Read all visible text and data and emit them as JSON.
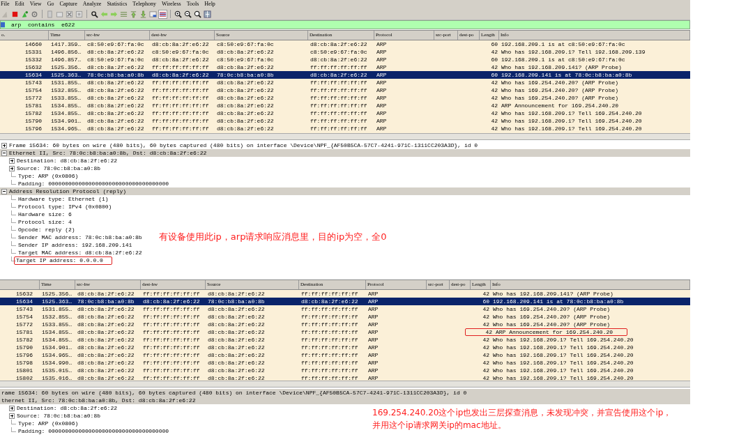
{
  "menu": [
    "File",
    "Edit",
    "View",
    "Go",
    "Capture",
    "Analyze",
    "Statistics",
    "Telephony",
    "Wireless",
    "Tools",
    "Help"
  ],
  "filter": {
    "value": "arp  contains  e622"
  },
  "panes": [
    {
      "columns": [
        "o.",
        "Time",
        "src-hw",
        "dest-hw",
        "Source",
        "Destination",
        "Protocol",
        "src-port",
        "dest-po",
        "Length",
        "Info"
      ],
      "rows": [
        {
          "no": "14660",
          "time": "1417.359…",
          "src_hw": "c8:50:e9:67:fa:0c",
          "dest_hw": "d8:cb:8a:2f:e6:22",
          "source": "c8:50:e9:67:fa:0c",
          "destination": "d8:cb:8a:2f:e6:22",
          "protocol": "ARP",
          "length": "60",
          "info": "192.168.209.1 is at c8:50:e9:67:fa:0c",
          "selected": false
        },
        {
          "no": "15331",
          "time": "1496.856…",
          "src_hw": "d8:cb:8a:2f:e6:22",
          "dest_hw": "c8:50:e9:67:fa:0c",
          "source": "d8:cb:8a:2f:e6:22",
          "destination": "c8:50:e9:67:fa:0c",
          "protocol": "ARP",
          "length": "42",
          "info": "Who has 192.168.209.1? Tell 192.168.209.139",
          "selected": false
        },
        {
          "no": "15332",
          "time": "1496.857…",
          "src_hw": "c8:50:e9:67:fa:0c",
          "dest_hw": "d8:cb:8a:2f:e6:22",
          "source": "c8:50:e9:67:fa:0c",
          "destination": "d8:cb:8a:2f:e6:22",
          "protocol": "ARP",
          "length": "60",
          "info": "192.168.209.1 is at c8:50:e9:67:fa:0c",
          "selected": false
        },
        {
          "no": "15632",
          "time": "1525.356…",
          "src_hw": "d8:cb:8a:2f:e6:22",
          "dest_hw": "ff:ff:ff:ff:ff:ff",
          "source": "d8:cb:8a:2f:e6:22",
          "destination": "ff:ff:ff:ff:ff:ff",
          "protocol": "ARP",
          "length": "42",
          "info": "Who has 192.168.209.141? (ARP Probe)",
          "selected": false
        },
        {
          "no": "15634",
          "time": "1525.363…",
          "src_hw": "78:0c:b8:ba:a0:8b",
          "dest_hw": "d8:cb:8a:2f:e6:22",
          "source": "78:0c:b8:ba:a0:8b",
          "destination": "d8:cb:8a:2f:e6:22",
          "protocol": "ARP",
          "length": "60",
          "info": "192.168.209.141 is at 78:0c:b8:ba:a0:8b",
          "selected": true
        },
        {
          "no": "15743",
          "time": "1531.855…",
          "src_hw": "d8:cb:8a:2f:e6:22",
          "dest_hw": "ff:ff:ff:ff:ff:ff",
          "source": "d8:cb:8a:2f:e6:22",
          "destination": "ff:ff:ff:ff:ff:ff",
          "protocol": "ARP",
          "length": "42",
          "info": "Who has 169.254.240.20? (ARP Probe)",
          "selected": false
        },
        {
          "no": "15754",
          "time": "1532.855…",
          "src_hw": "d8:cb:8a:2f:e6:22",
          "dest_hw": "ff:ff:ff:ff:ff:ff",
          "source": "d8:cb:8a:2f:e6:22",
          "destination": "ff:ff:ff:ff:ff:ff",
          "protocol": "ARP",
          "length": "42",
          "info": "Who has 169.254.240.20? (ARP Probe)",
          "selected": false
        },
        {
          "no": "15772",
          "time": "1533.855…",
          "src_hw": "d8:cb:8a:2f:e6:22",
          "dest_hw": "ff:ff:ff:ff:ff:ff",
          "source": "d8:cb:8a:2f:e6:22",
          "destination": "ff:ff:ff:ff:ff:ff",
          "protocol": "ARP",
          "length": "42",
          "info": "Who has 169.254.240.20? (ARP Probe)",
          "selected": false
        },
        {
          "no": "15781",
          "time": "1534.855…",
          "src_hw": "d8:cb:8a:2f:e6:22",
          "dest_hw": "ff:ff:ff:ff:ff:ff",
          "source": "d8:cb:8a:2f:e6:22",
          "destination": "ff:ff:ff:ff:ff:ff",
          "protocol": "ARP",
          "length": "42",
          "info": "ARP Announcement for 169.254.240.20",
          "selected": false
        },
        {
          "no": "15782",
          "time": "1534.855…",
          "src_hw": "d8:cb:8a:2f:e6:22",
          "dest_hw": "ff:ff:ff:ff:ff:ff",
          "source": "d8:cb:8a:2f:e6:22",
          "destination": "ff:ff:ff:ff:ff:ff",
          "protocol": "ARP",
          "length": "42",
          "info": "Who has 192.168.209.1? Tell 169.254.240.20",
          "selected": false
        },
        {
          "no": "15790",
          "time": "1534.901…",
          "src_hw": "d8:cb:8a:2f:e6:22",
          "dest_hw": "ff:ff:ff:ff:ff:ff",
          "source": "d8:cb:8a:2f:e6:22",
          "destination": "ff:ff:ff:ff:ff:ff",
          "protocol": "ARP",
          "length": "42",
          "info": "Who has 192.168.209.1? Tell 169.254.240.20",
          "selected": false
        },
        {
          "no": "15796",
          "time": "1534.965…",
          "src_hw": "d8:cb:8a:2f:e6:22",
          "dest_hw": "ff:ff:ff:ff:ff:ff",
          "source": "d8:cb:8a:2f:e6:22",
          "destination": "ff:ff:ff:ff:ff:ff",
          "protocol": "ARP",
          "length": "42",
          "info": "Who has 192.168.209.1? Tell 169.254.240.20",
          "selected": false
        }
      ],
      "details": [
        {
          "text": "Frame 15634: 60 bytes on wire (480 bits), 60 bytes captured (480 bits) on interface \\Device\\NPF_{AF50B5CA-57C7-4241-971C-1311CC203A3D}, id 0",
          "expandable": true,
          "expanded": false,
          "shaded": false
        },
        {
          "text": "Ethernet II, Src: 78:0c:b8:ba:a0:8b, Dst: d8:cb:8a:2f:e6:22",
          "expandable": true,
          "expanded": true,
          "shaded": true,
          "children": [
            {
              "text": "Destination: d8:cb:8a:2f:e6:22",
              "expandable": true,
              "expanded": false
            },
            {
              "text": "Source: 78:0c:b8:ba:a0:8b",
              "expandable": true,
              "expanded": false
            },
            {
              "text": "Type: ARP (0x0806)"
            },
            {
              "text": "Padding: 000000000000000000000000000000000000"
            }
          ]
        },
        {
          "text": "Address Resolution Protocol (reply)",
          "expandable": true,
          "expanded": true,
          "shaded": true,
          "children": [
            {
              "text": "Hardware type: Ethernet (1)"
            },
            {
              "text": "Protocol type: IPv4 (0x0800)"
            },
            {
              "text": "Hardware size: 6"
            },
            {
              "text": "Protocol size: 4"
            },
            {
              "text": "Opcode: reply (2)"
            },
            {
              "text": "Sender MAC address: 78:0c:b8:ba:a0:8b"
            },
            {
              "text": "Sender IP address: 192.168.209.141"
            },
            {
              "text": "Target MAC address: d8:cb:8a:2f:e6:22"
            },
            {
              "text": "Target IP address: 0.0.0.0",
              "boxed": true
            }
          ]
        }
      ],
      "annotation": [
        "有设备使用此ip，arp请求响应消息里，目的ip为空，全0"
      ]
    },
    {
      "columns": [
        "Time",
        "src-hw",
        "dest-hw",
        "Source",
        "Destination",
        "Protocol",
        "src-port",
        "dest-po",
        "Length",
        "Info"
      ],
      "rows": [
        {
          "no": "15632",
          "time": "1525.356…",
          "src_hw": "d8:cb:8a:2f:e6:22",
          "dest_hw": "ff:ff:ff:ff:ff:ff",
          "source": "d8:cb:8a:2f:e6:22",
          "destination": "ff:ff:ff:ff:ff:ff",
          "protocol": "ARP",
          "length": "42",
          "info": "Who has 192.168.209.141? (ARP Probe)",
          "selected": false
        },
        {
          "no": "15634",
          "time": "1525.363…",
          "src_hw": "78:0c:b8:ba:a0:8b",
          "dest_hw": "d8:cb:8a:2f:e6:22",
          "source": "78:0c:b8:ba:a0:8b",
          "destination": "d8:cb:8a:2f:e6:22",
          "protocol": "ARP",
          "length": "60",
          "info": "192.168.209.141 is at 78:0c:b8:ba:a0:8b",
          "selected": true
        },
        {
          "no": "15743",
          "time": "1531.855…",
          "src_hw": "d8:cb:8a:2f:e6:22",
          "dest_hw": "ff:ff:ff:ff:ff:ff",
          "source": "d8:cb:8a:2f:e6:22",
          "destination": "ff:ff:ff:ff:ff:ff",
          "protocol": "ARP",
          "length": "42",
          "info": "Who has 169.254.240.20? (ARP Probe)",
          "selected": false
        },
        {
          "no": "15754",
          "time": "1532.855…",
          "src_hw": "d8:cb:8a:2f:e6:22",
          "dest_hw": "ff:ff:ff:ff:ff:ff",
          "source": "d8:cb:8a:2f:e6:22",
          "destination": "ff:ff:ff:ff:ff:ff",
          "protocol": "ARP",
          "length": "42",
          "info": "Who has 169.254.240.20? (ARP Probe)",
          "selected": false
        },
        {
          "no": "15772",
          "time": "1533.855…",
          "src_hw": "d8:cb:8a:2f:e6:22",
          "dest_hw": "ff:ff:ff:ff:ff:ff",
          "source": "d8:cb:8a:2f:e6:22",
          "destination": "ff:ff:ff:ff:ff:ff",
          "protocol": "ARP",
          "length": "42",
          "info": "Who has 169.254.240.20? (ARP Probe)",
          "selected": false
        },
        {
          "no": "15781",
          "time": "1534.855…",
          "src_hw": "d8:cb:8a:2f:e6:22",
          "dest_hw": "ff:ff:ff:ff:ff:ff",
          "source": "d8:cb:8a:2f:e6:22",
          "destination": "ff:ff:ff:ff:ff:ff",
          "protocol": "ARP",
          "length": "42",
          "info": "ARP Announcement for 169.254.240.20",
          "selected": false,
          "boxed": true
        },
        {
          "no": "15782",
          "time": "1534.855…",
          "src_hw": "d8:cb:8a:2f:e6:22",
          "dest_hw": "ff:ff:ff:ff:ff:ff",
          "source": "d8:cb:8a:2f:e6:22",
          "destination": "ff:ff:ff:ff:ff:ff",
          "protocol": "ARP",
          "length": "42",
          "info": "Who has 192.168.209.1? Tell 169.254.240.20",
          "selected": false
        },
        {
          "no": "15790",
          "time": "1534.901…",
          "src_hw": "d8:cb:8a:2f:e6:22",
          "dest_hw": "ff:ff:ff:ff:ff:ff",
          "source": "d8:cb:8a:2f:e6:22",
          "destination": "ff:ff:ff:ff:ff:ff",
          "protocol": "ARP",
          "length": "42",
          "info": "Who has 192.168.209.1? Tell 169.254.240.20",
          "selected": false
        },
        {
          "no": "15796",
          "time": "1534.965…",
          "src_hw": "d8:cb:8a:2f:e6:22",
          "dest_hw": "ff:ff:ff:ff:ff:ff",
          "source": "d8:cb:8a:2f:e6:22",
          "destination": "ff:ff:ff:ff:ff:ff",
          "protocol": "ARP",
          "length": "42",
          "info": "Who has 192.168.209.1? Tell 169.254.240.20",
          "selected": false
        },
        {
          "no": "15798",
          "time": "1534.990…",
          "src_hw": "d8:cb:8a:2f:e6:22",
          "dest_hw": "ff:ff:ff:ff:ff:ff",
          "source": "d8:cb:8a:2f:e6:22",
          "destination": "ff:ff:ff:ff:ff:ff",
          "protocol": "ARP",
          "length": "42",
          "info": "Who has 192.168.209.1? Tell 169.254.240.20",
          "selected": false
        },
        {
          "no": "15801",
          "time": "1535.015…",
          "src_hw": "d8:cb:8a:2f:e6:22",
          "dest_hw": "ff:ff:ff:ff:ff:ff",
          "source": "d8:cb:8a:2f:e6:22",
          "destination": "ff:ff:ff:ff:ff:ff",
          "protocol": "ARP",
          "length": "42",
          "info": "Who has 192.168.209.1? Tell 169.254.240.20",
          "selected": false
        },
        {
          "no": "15802",
          "time": "1535.016…",
          "src_hw": "d8:cb:8a:2f:e6:22",
          "dest_hw": "ff:ff:ff:ff:ff:ff",
          "source": "d8:cb:8a:2f:e6:22",
          "destination": "ff:ff:ff:ff:ff:ff",
          "protocol": "ARP",
          "length": "42",
          "info": "Who has 192.168.209.1? Tell 169.254.240.20",
          "selected": false
        }
      ],
      "details": [
        {
          "text": "rame 15634: 60 bytes on wire (480 bits), 60 bytes captured (480 bits) on interface \\Device\\NPF_{AF50B5CA-57C7-4241-971C-1311CC203A3D}, id 0",
          "shaded": true
        },
        {
          "text": "thernet II, Src: 78:0c:b8:ba:a0:8b, Dst: d8:cb:8a:2f:e6:22",
          "shaded": true,
          "children": [
            {
              "text": "Destination: d8:cb:8a:2f:e6:22",
              "expandable": true,
              "expanded": false
            },
            {
              "text": "Source: 78:0c:b8:ba:a0:8b",
              "expandable": true,
              "expanded": false
            },
            {
              "text": "Type: ARP (0x0806)"
            },
            {
              "text": "Padding: 000000000000000000000000000000000000"
            }
          ]
        }
      ],
      "annotation": [
        "169.254.240.20这个ip也发出三层探查消息，未发现冲突，并宣告使用这个ip，",
        "并用这个ip请求网关ip的mac地址。"
      ]
    }
  ]
}
